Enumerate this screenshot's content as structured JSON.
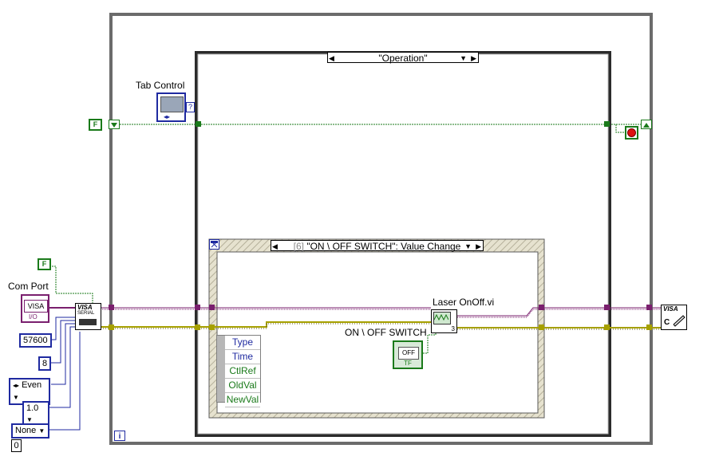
{
  "colors": {
    "frame_gray": "#6b6b6b",
    "wire_purple": "#7a1f6e",
    "wire_yellow": "#a6a000",
    "wire_green": "#1a7a1a",
    "numeric_blue": "#1f2aa0"
  },
  "diagram": {
    "tab_control_label": "Tab Control",
    "com_port_label": "Com Port",
    "visa_control_text": "VISA",
    "visa_control_sub": "I/O",
    "serial_config_text": "VISA",
    "serial_config_sub": "SERIAL",
    "close_node_text": "VISA",
    "close_node_sub": "C",
    "false_const_top": "F",
    "false_const_left": "F",
    "baud_const": "57600",
    "data_bits_const": "8",
    "parity_const": "Even",
    "stop_bits_const": "1.0",
    "flow_const": "None",
    "error_const": "0",
    "while_loop_iter": "i",
    "outer_case_selector": "\"Operation\"",
    "event_selector_index": "[6]",
    "event_selector_text": "\"ON \\ OFF SWITCH\": Value Change",
    "subvi_label": "Laser OnOff.vi",
    "subvi_count": "3",
    "switch_label": "ON \\ OFF SWITCH",
    "switch_text": "OFF",
    "switch_sub": "TF",
    "tab_unknown_icon": "?",
    "event_data_items": [
      {
        "label": "Type",
        "tone": "blue"
      },
      {
        "label": "Time",
        "tone": "blue"
      },
      {
        "label": "CtlRef",
        "tone": "green"
      },
      {
        "label": "OldVal",
        "tone": "green"
      },
      {
        "label": "NewVal",
        "tone": "green"
      }
    ]
  }
}
